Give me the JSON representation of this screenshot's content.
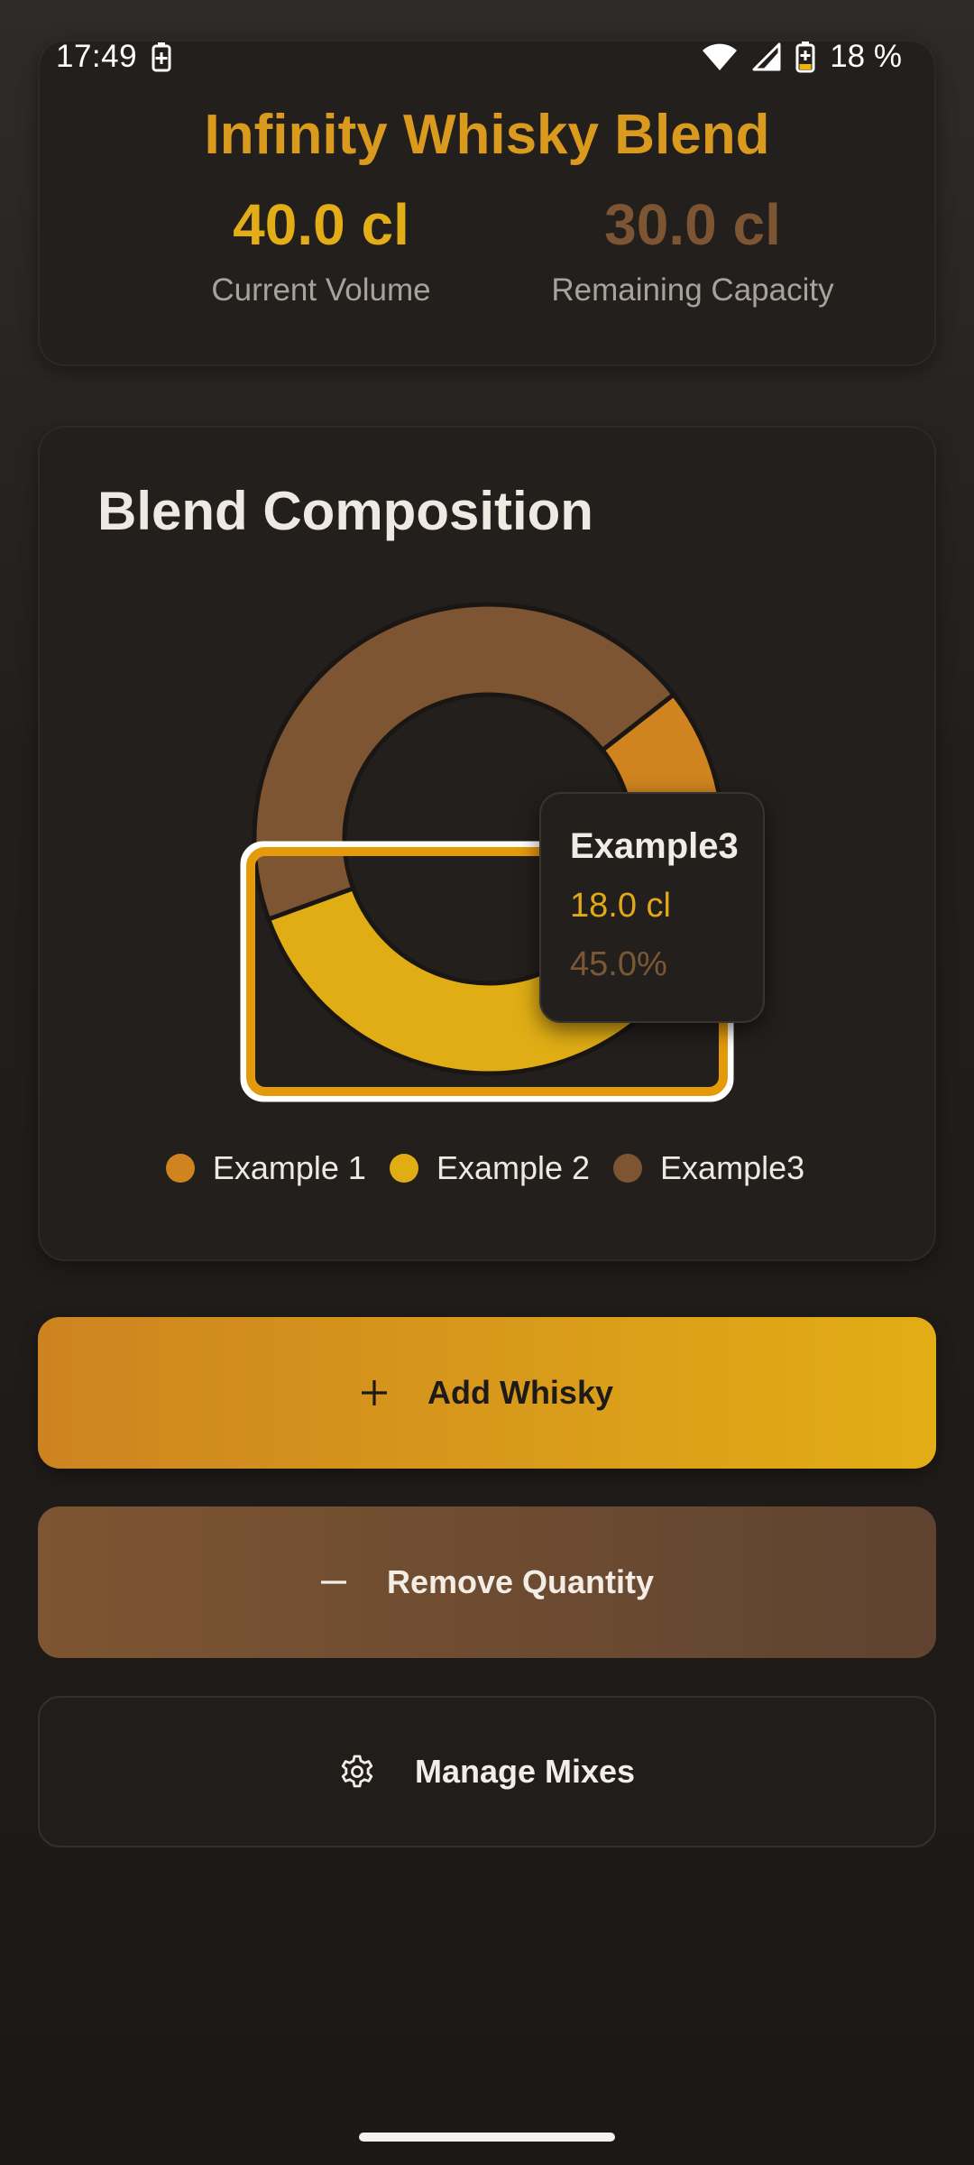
{
  "status_bar": {
    "time": "17:49",
    "battery_percent": "18 %"
  },
  "summary": {
    "title": "Infinity Whisky Blend",
    "current_volume_value": "40.0 cl",
    "current_volume_label": "Current Volume",
    "remaining_capacity_value": "30.0 cl",
    "remaining_capacity_label": "Remaining Capacity"
  },
  "composition": {
    "title": "Blend Composition",
    "legend": [
      {
        "label": "Example 1",
        "color": "#cf8420"
      },
      {
        "label": "Example 2",
        "color": "#e0ad15"
      },
      {
        "label": "Example3",
        "color": "#7d5532"
      }
    ],
    "tooltip": {
      "name": "Example3",
      "value": "18.0 cl",
      "percent": "45.0%"
    }
  },
  "chart_data": {
    "type": "pie",
    "categories": [
      "Example 1",
      "Example 2",
      "Example3"
    ],
    "values": [
      4.0,
      18.0,
      18.0
    ],
    "colors": [
      "#cf8420",
      "#e0ad15",
      "#7d5532"
    ],
    "highlighted": "Example3",
    "donut": true
  },
  "actions": {
    "add_label": "Add Whisky",
    "remove_label": "Remove Quantity",
    "manage_label": "Manage Mixes"
  },
  "icons": {
    "add": "plus-icon",
    "remove": "minus-icon",
    "manage": "gear-icon"
  },
  "colors": {
    "accent_gold": "#e3ad17",
    "accent_orange": "#cf8420",
    "accent_brown": "#7d5532",
    "background": "#1c1816",
    "card": "#231f1d"
  }
}
